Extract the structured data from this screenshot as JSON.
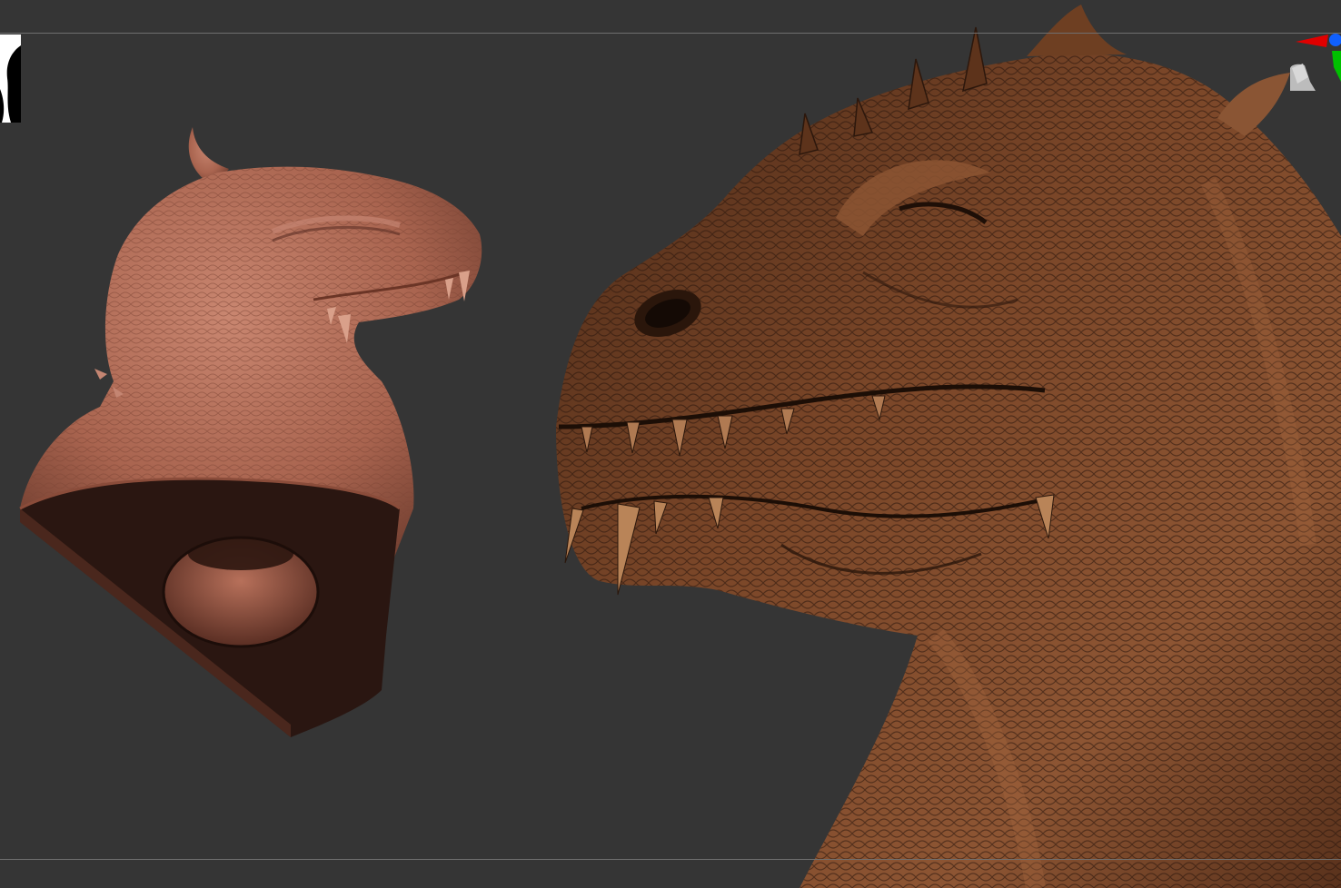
{
  "app": {
    "name": "",
    "view": "sculpt-viewport"
  },
  "viewport": {
    "background_color": "#353535",
    "frame_line_color": "#6f6f6f"
  },
  "models": [
    {
      "id": "bust-clay",
      "kind": "dragon bust with base cavity",
      "material_color": "#b06a55",
      "cut_color": "#2b1712"
    },
    {
      "id": "head-textured",
      "kind": "dragon head close-up, textured",
      "material_color": "#6a3b20"
    }
  ],
  "gizmo": {
    "axes": [
      {
        "axis": "x",
        "color": "#e00000"
      },
      {
        "axis": "y",
        "color": "#00c000"
      },
      {
        "axis": "z",
        "color": "#1060ff"
      }
    ]
  },
  "icons": [
    "thumbnail-icon",
    "axis-gizmo-icon",
    "camera-head-icon"
  ]
}
